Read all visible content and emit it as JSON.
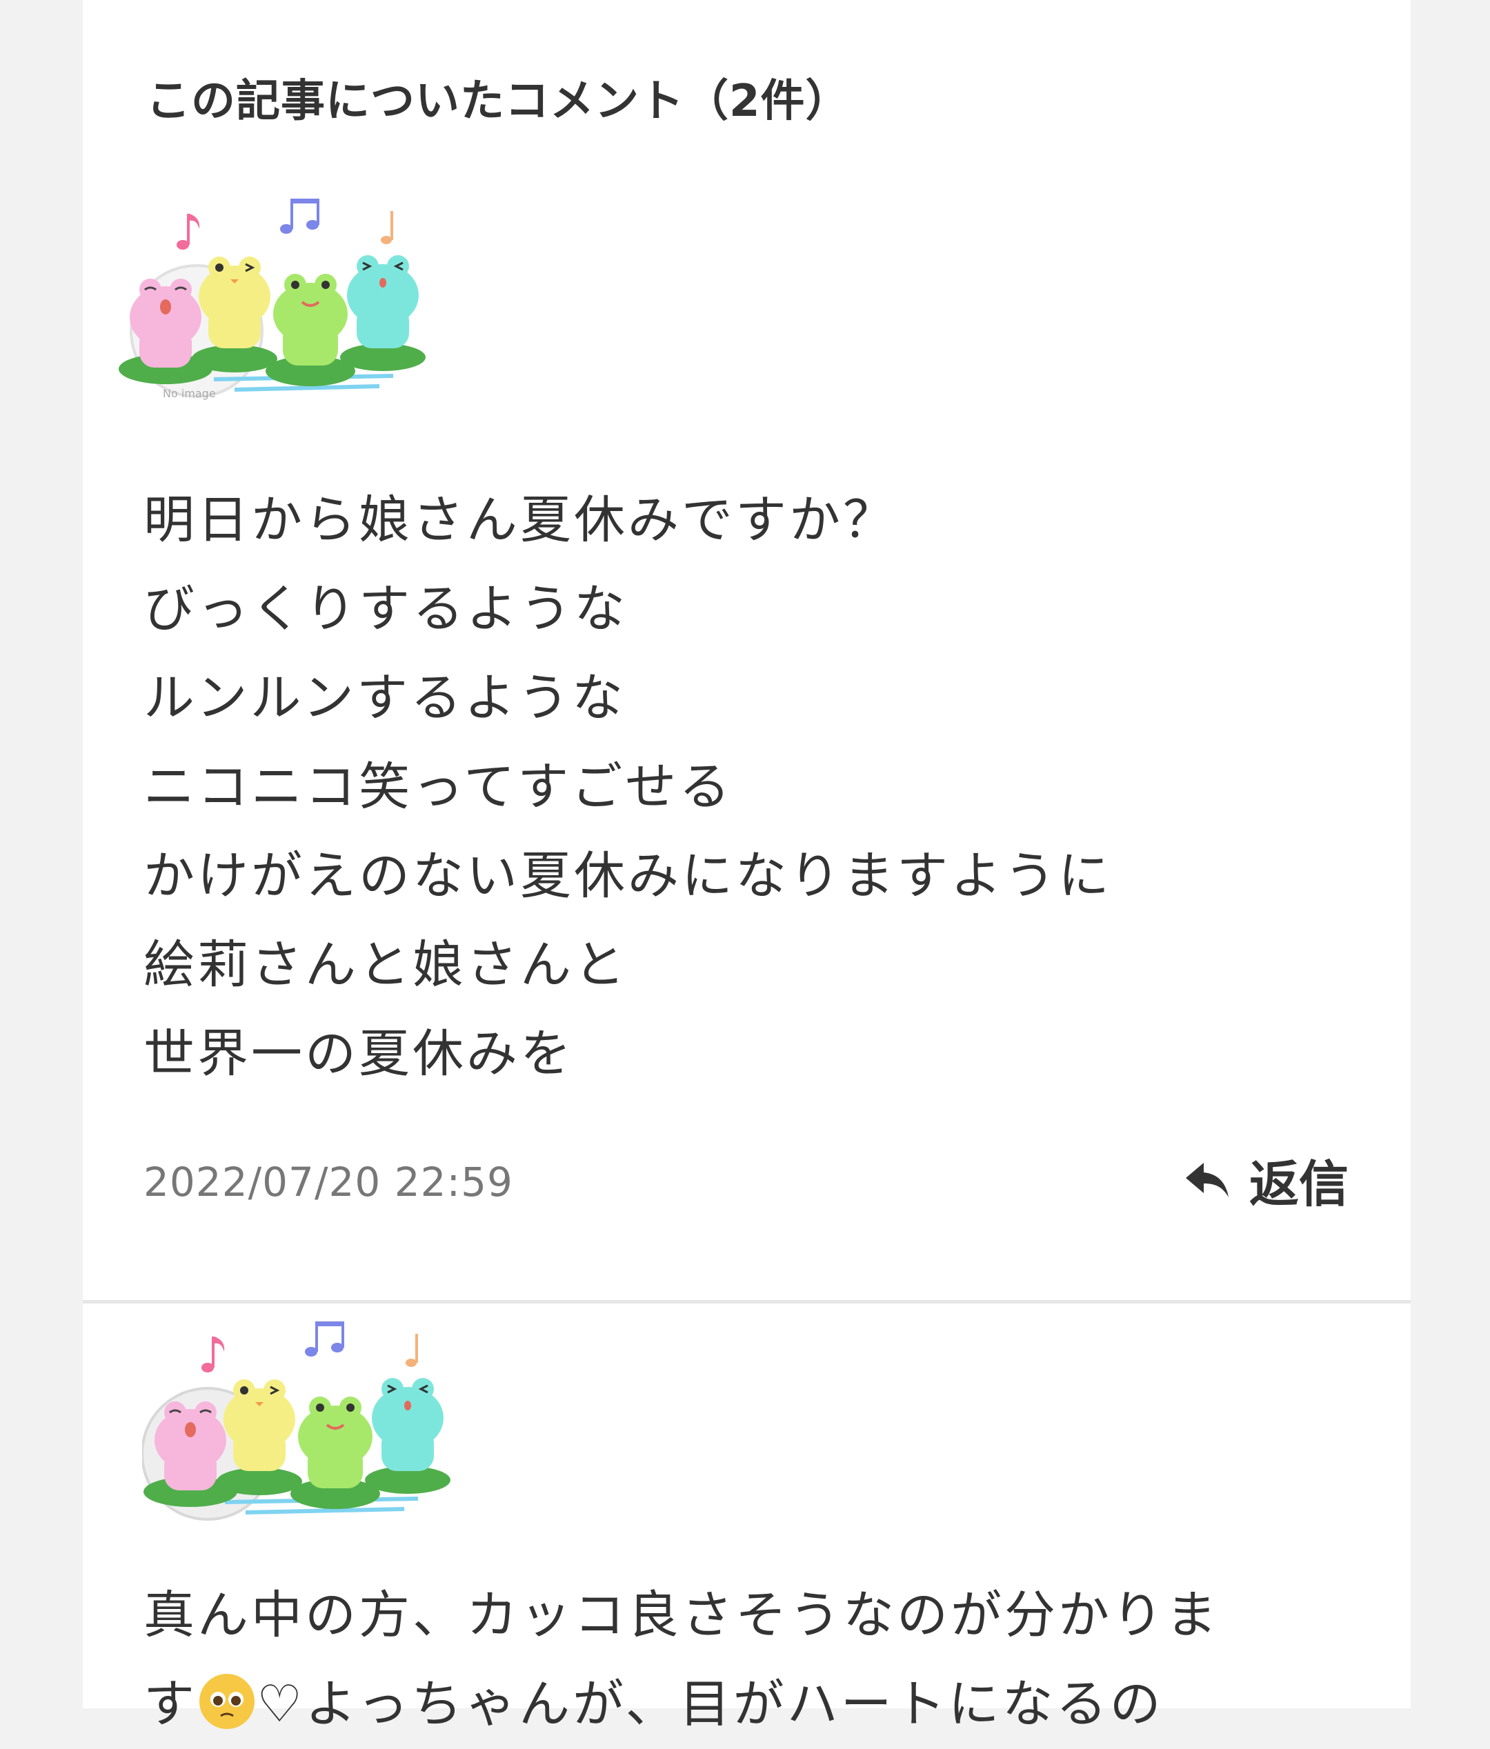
{
  "section": {
    "title": "この記事についたコメント（2件）"
  },
  "comments": [
    {
      "avatar_icon": "frogs-singing-avatar",
      "lines": [
        "明日から娘さん夏休みですか？",
        "びっくりするような",
        "ルンルンするような",
        "ニコニコ笑ってすごせる",
        "かけがえのない夏休みになりますように",
        "絵莉さんと娘さんと",
        "世界一の夏休みを"
      ],
      "timestamp": "2022/07/20 22:59",
      "reply_label": "返信"
    },
    {
      "avatar_icon": "frogs-singing-avatar",
      "lines": [
        "真ん中の方、カッコ良さそうなのが分かりま",
        "す",
        "♡よっちゃんが、目がハートになるの"
      ]
    }
  ],
  "colors": {
    "background": "#f2f2f2",
    "panel": "#ffffff",
    "text": "#333333",
    "timestamp": "#777777",
    "divider": "#e6e6e6"
  }
}
